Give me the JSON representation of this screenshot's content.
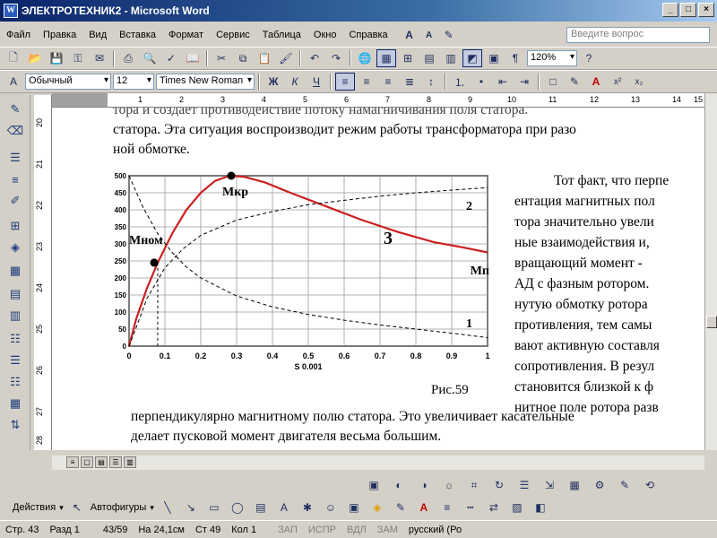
{
  "window": {
    "title": "ЭЛЕКТРОТЕХНИК2 - Microsoft Word",
    "app_icon": "W"
  },
  "menu": [
    "Файл",
    "Правка",
    "Вид",
    "Вставка",
    "Формат",
    "Сервис",
    "Таблица",
    "Окно",
    "Справка"
  ],
  "help_box": {
    "placeholder": "Введите вопрос"
  },
  "toolbar_standard": {
    "zoom": "120%"
  },
  "toolbar_format": {
    "style": "Обычный",
    "size": "12",
    "font": "Times New Roman",
    "bold": "Ж",
    "italic": "К",
    "underline": "Ч"
  },
  "ruler_h": [
    "1",
    "2",
    "3",
    "4",
    "5",
    "6",
    "7",
    "8",
    "9",
    "10",
    "11",
    "12",
    "13",
    "14",
    "15"
  ],
  "ruler_v": [
    "20",
    "21",
    "22",
    "23",
    "24",
    "25",
    "26",
    "27",
    "28"
  ],
  "document": {
    "top_line": "тора и создает противодействие потоку намагничивания поля статора.",
    "line1": "статора. Эта ситуация воспроизводит режим работы трансформатора при разо",
    "line2": "ной обмотке.",
    "right_col": [
      "Тот факт, что перпе",
      "ентация магнитных пол",
      "тора значительно увели",
      "ные взаимодействия и,",
      "вращающий момент -",
      "АД с фазным ротором.",
      "нутую обмотку ротора",
      "противления, тем самы",
      "вают активную составля",
      "сопротивления. В резул",
      "становится близкой к ф",
      "нитное поле ротора разв"
    ],
    "caption": "Рис.59",
    "bottom_line1": "перпендикулярно магнитному полю статора. Это увеличивает касательные",
    "bottom_line2": "делает пусковой момент двигателя весьма большим."
  },
  "chart_data": {
    "type": "line",
    "xlabel": "S 0.001",
    "xlim": [
      0,
      1
    ],
    "ylim": [
      0,
      500
    ],
    "x_ticks": [
      "0",
      "0.1",
      "0.2",
      "0.3",
      "0.4",
      "0.5",
      "0.6",
      "0.7",
      "0.8",
      "0.9",
      "1"
    ],
    "y_ticks": [
      "0",
      "50",
      "100",
      "150",
      "200",
      "250",
      "300",
      "350",
      "400",
      "450",
      "500"
    ],
    "series": [
      {
        "name": "3",
        "style": "solid",
        "color": "#cc2020",
        "x": [
          0,
          0.02,
          0.05,
          0.08,
          0.12,
          0.16,
          0.2,
          0.24,
          0.28,
          0.32,
          0.38,
          0.45,
          0.55,
          0.65,
          0.75,
          0.85,
          0.93,
          1
        ],
        "y": [
          0,
          80,
          170,
          245,
          330,
          400,
          450,
          485,
          500,
          497,
          480,
          450,
          410,
          370,
          335,
          305,
          290,
          275
        ]
      },
      {
        "name": "2",
        "style": "dashed",
        "color": "#000000",
        "x": [
          0,
          0.02,
          0.05,
          0.1,
          0.15,
          0.2,
          0.3,
          0.4,
          0.5,
          0.6,
          0.7,
          0.8,
          0.9,
          1
        ],
        "y": [
          0,
          55,
          140,
          230,
          285,
          325,
          370,
          395,
          415,
          428,
          440,
          450,
          458,
          465
        ]
      },
      {
        "name": "1",
        "style": "dashed",
        "color": "#000000",
        "x": [
          0,
          0.04,
          0.08,
          0.12,
          0.16,
          0.2,
          0.3,
          0.4,
          0.5,
          0.6,
          0.7,
          0.8,
          0.9,
          1
        ],
        "y": [
          500,
          405,
          330,
          275,
          232,
          200,
          147,
          115,
          93,
          76,
          62,
          50,
          38,
          25
        ]
      }
    ],
    "points": [
      {
        "label": "Мкр",
        "x": 0.285,
        "y": 500
      },
      {
        "label": "Мном",
        "x": 0.07,
        "y": 245
      }
    ],
    "annotations": {
      "curve3": "3",
      "curve2": "2",
      "curve1": "1",
      "mp": "Мп"
    }
  },
  "drawing_toolbar": {
    "actions": "Действия",
    "autoshapes": "Автофигуры"
  },
  "status": {
    "page": "Стр. 43",
    "section": "Разд 1",
    "pages": "43/59",
    "at": "На 24,1см",
    "line": "Ст 49",
    "col": "Кол 1",
    "rec": "ЗАП",
    "trk": "ИСПР",
    "ext": "ВДЛ",
    "ovr": "ЗАМ",
    "lang": "русский (Ро"
  }
}
